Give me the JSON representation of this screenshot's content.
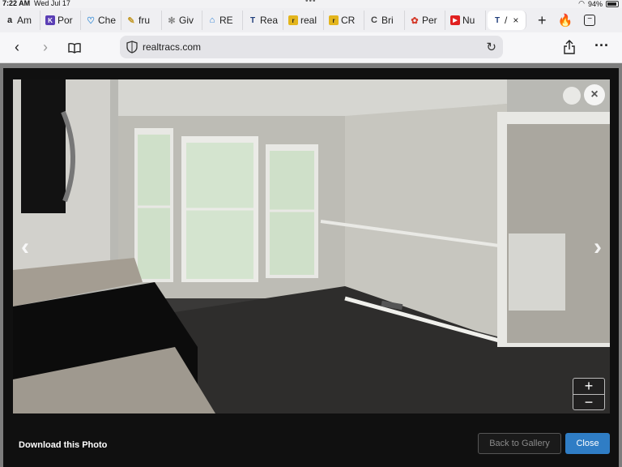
{
  "status": {
    "time": "7:22 AM",
    "date": "Wed Jul 17",
    "battery": "94%"
  },
  "tabs": [
    {
      "label": "Am",
      "icon": "amazon-icon",
      "color": "#222222"
    },
    {
      "label": "Por",
      "icon": "portal-icon",
      "color": "#5b3fb5"
    },
    {
      "label": "Che",
      "icon": "heart-icon",
      "color": "#3a8fd8"
    },
    {
      "label": "fru",
      "icon": "fruit-icon",
      "color": "#c49a2a"
    },
    {
      "label": "Giv",
      "icon": "gear-icon",
      "color": "#888888"
    },
    {
      "label": "RE",
      "icon": "house-icon",
      "color": "#2a7fd4"
    },
    {
      "label": "Rea",
      "icon": "realtracs-icon",
      "color": "#1f3d7a"
    },
    {
      "label": "real",
      "icon": "realtor-icon",
      "color": "#e3b51d"
    },
    {
      "label": "CR",
      "icon": "cr-icon",
      "color": "#e3b51d"
    },
    {
      "label": "Bri",
      "icon": "bri-icon",
      "color": "#444444"
    },
    {
      "label": "Per",
      "icon": "per-icon",
      "color": "#d43a2a"
    },
    {
      "label": "Nu",
      "icon": "youtube-icon",
      "color": "#e02020"
    },
    {
      "label": "/",
      "icon": "realtracs-icon",
      "color": "#1f3d7a"
    }
  ],
  "address": {
    "url": "realtracs.com"
  },
  "modal": {
    "download_label": "Download this Photo",
    "back_label": "Back to Gallery",
    "close_label": "Close",
    "zoom_in": "+",
    "zoom_out": "−",
    "prev": "‹",
    "next": "›",
    "close_x": "×"
  }
}
